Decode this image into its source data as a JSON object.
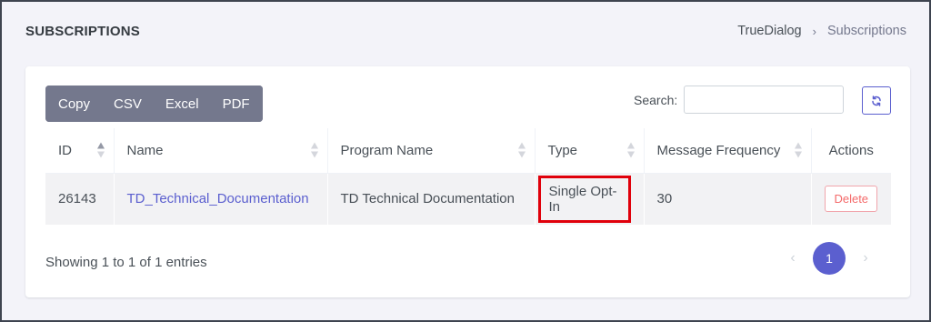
{
  "header": {
    "title": "SUBSCRIPTIONS",
    "breadcrumb": {
      "root": "TrueDialog",
      "separator": "›",
      "current": "Subscriptions"
    }
  },
  "toolbar": {
    "export_buttons": [
      "Copy",
      "CSV",
      "Excel",
      "PDF"
    ],
    "search_label": "Search:",
    "search_value": "",
    "refresh_icon": "refresh-icon"
  },
  "table": {
    "columns": [
      "ID",
      "Name",
      "Program Name",
      "Type",
      "Message Frequency",
      "Actions"
    ],
    "sorted_column": "ID",
    "rows": [
      {
        "id": "26143",
        "name": "TD_Technical_Documentation",
        "program_name": "TD Technical Documentation",
        "type": "Single Opt-In",
        "message_frequency": "30",
        "action": "Delete"
      }
    ]
  },
  "footer": {
    "info": "Showing 1 to 1 of 1 entries",
    "pagination": {
      "prev": "‹",
      "current_page": "1",
      "next": "›"
    }
  },
  "colors": {
    "accent": "#5b5fcf",
    "export_bg": "#74788d",
    "highlight_border": "#e0000b",
    "danger": "#f46a6a"
  }
}
